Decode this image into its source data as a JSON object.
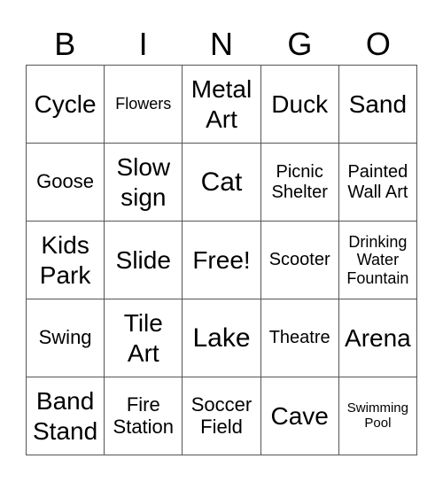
{
  "header": [
    "B",
    "I",
    "N",
    "G",
    "O"
  ],
  "cells": [
    {
      "label": "Cycle",
      "size": "s-l"
    },
    {
      "label": "Flowers",
      "size": "s-xs"
    },
    {
      "label": "Metal Art",
      "size": "s-l"
    },
    {
      "label": "Duck",
      "size": "s-l"
    },
    {
      "label": "Sand",
      "size": "s-l"
    },
    {
      "label": "Goose",
      "size": "s-m"
    },
    {
      "label": "Slow sign",
      "size": "s-l"
    },
    {
      "label": "Cat",
      "size": "s-xl"
    },
    {
      "label": "Picnic Shelter",
      "size": "s-s"
    },
    {
      "label": "Painted Wall Art",
      "size": "s-s"
    },
    {
      "label": "Kids Park",
      "size": "s-l"
    },
    {
      "label": "Slide",
      "size": "s-l"
    },
    {
      "label": "Free!",
      "size": "s-l"
    },
    {
      "label": "Scooter",
      "size": "s-s"
    },
    {
      "label": "Drinking Water Fountain",
      "size": "s-xs"
    },
    {
      "label": "Swing",
      "size": "s-m"
    },
    {
      "label": "Tile Art",
      "size": "s-l"
    },
    {
      "label": "Lake",
      "size": "s-xl"
    },
    {
      "label": "Theatre",
      "size": "s-s"
    },
    {
      "label": "Arena",
      "size": "s-l"
    },
    {
      "label": "Band Stand",
      "size": "s-l"
    },
    {
      "label": "Fire Station",
      "size": "s-m"
    },
    {
      "label": "Soccer Field",
      "size": "s-m"
    },
    {
      "label": "Cave",
      "size": "s-l"
    },
    {
      "label": "Swimming Pool",
      "size": "s-xxs"
    }
  ]
}
